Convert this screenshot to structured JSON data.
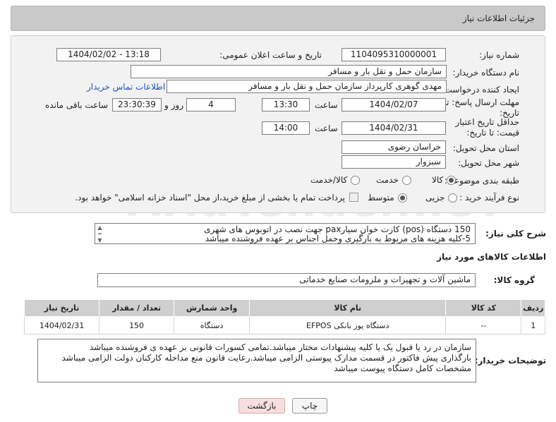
{
  "header": {
    "title": "جزئیات اطلاعات نیاز"
  },
  "form": {
    "need_number_label": "شماره نیاز:",
    "need_number": "1104095310000001",
    "announce_label": "تاریخ و ساعت اعلان عمومی:",
    "announce_value": "1404/02/02 - 13:18",
    "buyer_org_label": "نام دستگاه خریدار:",
    "buyer_org": "سازمان حمل و نقل بار و مسافر",
    "creator_label": "ایجاد کننده درخواست:",
    "creator": "مهدی گوهری کارپرداز سازمان حمل و نقل بار و مسافر",
    "contact_link": "اطلاعات تماس خریدار",
    "deadline_label": "مهلت ارسال پاسخ: تا تاریخ:",
    "deadline_date": "1404/02/07",
    "time_label": "ساعت",
    "deadline_time": "13:30",
    "days_value": "4",
    "days_label": "روز و",
    "remaining_time": "23:30:39",
    "remaining_label": "ساعت باقی مانده",
    "price_valid_label": "حداقل تاریخ اعتبار قیمت: تا تاریخ:",
    "price_valid_date": "1404/02/31",
    "price_valid_time": "14:00",
    "province_label": "استان محل تحویل:",
    "province": "خراسان رضوی",
    "city_label": "شهر محل تحویل:",
    "city": "سبزوار",
    "category_label": "طبقه بندی موضوعی:",
    "category_options": [
      "کالا",
      "خدمت",
      "کالا/خدمت"
    ],
    "process_label": "نوع فرآیند خرید :",
    "process_options": [
      "جزیی",
      "متوسط"
    ],
    "payment_note": "پرداخت تمام یا بخشی از مبلغ خرید،از محل \"اسناد خزانه اسلامی\" خواهد بود."
  },
  "description": {
    "label": "شرح کلی نیاز:",
    "line1": "150 دستگاه (pos) کارت خوان سیارpax جهت نصب در اتوبوس های شهری",
    "line2": "5-کلیه هزینه های مربوط به بارگیری وحمل اجناس بر عهده فروشنده میباشد"
  },
  "goods_section": {
    "title": "اطلاعات کالاهای مورد نیاز",
    "group_label": "گروه کالا:",
    "group_value": "ماشین آلات و تجهیزات و ملزومات صنایع خدماتی",
    "columns": [
      "ردیف",
      "کد کالا",
      "نام کالا",
      "واحد شمارش",
      "تعداد / مقدار",
      "تاریخ نیاز"
    ],
    "rows": [
      {
        "index": "1",
        "code": "--",
        "name": "دستگاه پوز بانکی EFPOS",
        "unit": "دستگاه",
        "qty": "150",
        "date": "1404/02/31"
      }
    ]
  },
  "buyer_notes": {
    "label": "توضیحات خریدار:",
    "line1": "سازمان  در رد یا قبول یک یا کلیه پیشنهادات مختار میباشد.تمامی کسورات قانونی بر عهده ی فروشنده میباشد",
    "line2": "بارگذاری پیش فاکتور در قسمت مدارک پیوستی الزامی میباشد.رعایت قانون منع مداخله کارکنان دولت الزامی میباشد",
    "line3": "مشخصات کامل دستگاه پیوست میباشد"
  },
  "buttons": {
    "print": "چاپ",
    "back": "بازگشت"
  },
  "watermark": "AriaTender.neT"
}
